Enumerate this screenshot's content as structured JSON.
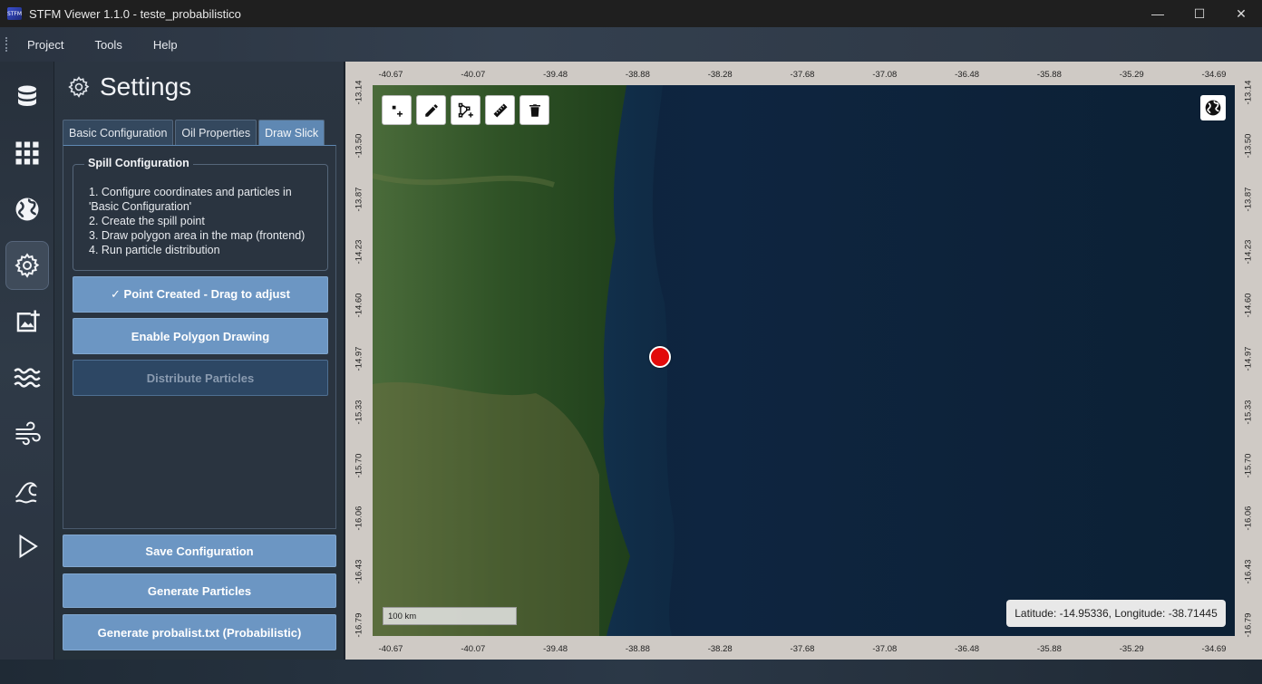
{
  "window": {
    "title": "STFM Viewer 1.1.0 - teste_probabilistico",
    "logo_text": "STFM",
    "minimize": "—",
    "maximize": "☐",
    "close": "✕"
  },
  "menu": [
    "Project",
    "Tools",
    "Help"
  ],
  "sidebar": {
    "items": [
      {
        "name": "database-icon",
        "active": false
      },
      {
        "name": "grid-icon",
        "active": false
      },
      {
        "name": "globe-icon",
        "active": false
      },
      {
        "name": "gear-icon",
        "active": true
      },
      {
        "name": "add-image-icon",
        "active": false
      },
      {
        "name": "waves-icon",
        "active": false
      },
      {
        "name": "wind-icon",
        "active": false
      },
      {
        "name": "wave-icon",
        "active": false
      },
      {
        "name": "play-icon",
        "active": false
      }
    ]
  },
  "settings": {
    "title": "Settings",
    "tabs": [
      {
        "label": "Basic Configuration",
        "active": false
      },
      {
        "label": "Oil Properties",
        "active": false
      },
      {
        "label": "Draw Slick",
        "active": true
      }
    ],
    "spill_group": {
      "title": "Spill Configuration",
      "steps": [
        "1. Configure coordinates and particles in 'Basic Configuration'",
        "2. Create the spill point",
        "3. Draw polygon area in the map (frontend)",
        "4. Run particle distribution"
      ]
    },
    "point_button": "✓ Point Created - Drag to adjust",
    "polygon_button": "Enable Polygon Drawing",
    "distribute_button": "Distribute Particles",
    "save_button": "Save Configuration",
    "generate_button": "Generate Particles",
    "probalist_button": "Generate probalist.txt (Probabilistic)"
  },
  "map": {
    "x_ticks": [
      "-40.67",
      "-40.07",
      "-39.48",
      "-38.88",
      "-38.28",
      "-37.68",
      "-37.08",
      "-36.48",
      "-35.88",
      "-35.29",
      "-34.69"
    ],
    "y_ticks": [
      "-13.14",
      "-13.50",
      "-13.87",
      "-14.23",
      "-14.60",
      "-14.97",
      "-15.33",
      "-15.70",
      "-16.06",
      "-16.43",
      "-16.79"
    ],
    "spill_point": {
      "lat": -14.95336,
      "lon": -38.71445
    },
    "scale_label": "100 km",
    "coord_readout": "Latitude: -14.95336, Longitude: -38.71445",
    "tools": [
      "add-point-icon",
      "pencil-icon",
      "add-polygon-icon",
      "ruler-icon",
      "trash-icon"
    ],
    "colors": {
      "marker": "#e20a0a",
      "ocean": "#0e2540",
      "land": "#3d5a2c"
    }
  }
}
